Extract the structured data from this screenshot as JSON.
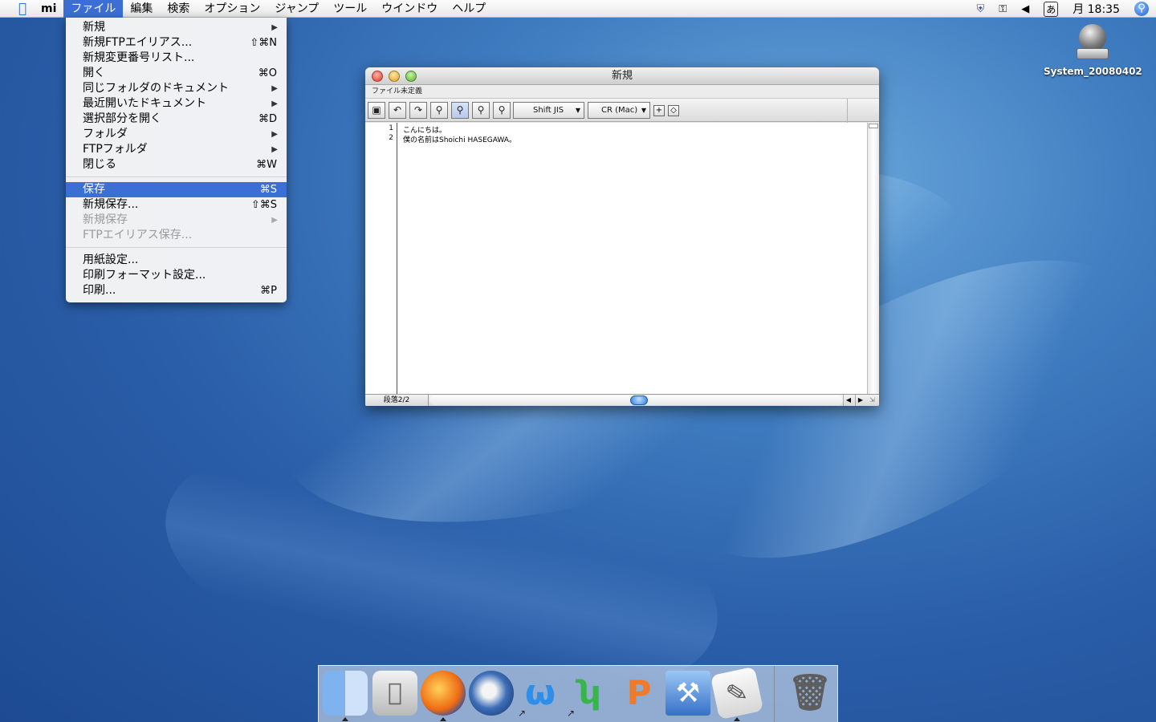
{
  "menubar": {
    "apple_icon": "apple-icon",
    "app_name": "mi",
    "menus": [
      "ファイル",
      "編集",
      "検索",
      "オプション",
      "ジャンプ",
      "ツール",
      "ウインドウ",
      "ヘルプ"
    ],
    "active_menu": "ファイル",
    "status_icons": [
      "shield-icon",
      "binoculars-icon",
      "volume-icon"
    ],
    "input_method": "あ",
    "clock": "月 18:35",
    "spotlight_icon": "spotlight-icon"
  },
  "file_menu": {
    "items": [
      {
        "label": "新規",
        "shortcut": "",
        "submenu": true,
        "state": "enabled"
      },
      {
        "label": "新規FTPエイリアス...",
        "shortcut": "⇧⌘N",
        "submenu": false,
        "state": "enabled"
      },
      {
        "label": "新規変更番号リスト...",
        "shortcut": "",
        "submenu": false,
        "state": "enabled"
      },
      {
        "label": "開く",
        "shortcut": "⌘O",
        "submenu": false,
        "state": "enabled"
      },
      {
        "label": "同じフォルダのドキュメント",
        "shortcut": "",
        "submenu": true,
        "state": "enabled"
      },
      {
        "label": "最近開いたドキュメント",
        "shortcut": "",
        "submenu": true,
        "state": "enabled"
      },
      {
        "label": "選択部分を開く",
        "shortcut": "⌘D",
        "submenu": false,
        "state": "enabled"
      },
      {
        "label": "フォルダ",
        "shortcut": "",
        "submenu": true,
        "state": "enabled"
      },
      {
        "label": "FTPフォルダ",
        "shortcut": "",
        "submenu": true,
        "state": "enabled"
      },
      {
        "label": "閉じる",
        "shortcut": "⌘W",
        "submenu": false,
        "state": "enabled"
      },
      {
        "label": "保存",
        "shortcut": "⌘S",
        "submenu": false,
        "state": "selected"
      },
      {
        "label": "新規保存...",
        "shortcut": "⇧⌘S",
        "submenu": false,
        "state": "enabled"
      },
      {
        "label": "新規保存",
        "shortcut": "",
        "submenu": true,
        "state": "disabled"
      },
      {
        "label": "FTPエイリアス保存...",
        "shortcut": "",
        "submenu": false,
        "state": "disabled"
      },
      {
        "label": "用紙設定...",
        "shortcut": "",
        "submenu": false,
        "state": "enabled"
      },
      {
        "label": "印刷フォーマット設定...",
        "shortcut": "",
        "submenu": false,
        "state": "enabled"
      },
      {
        "label": "印刷...",
        "shortcut": "⌘P",
        "submenu": false,
        "state": "enabled"
      }
    ]
  },
  "editor_window": {
    "title": "新規",
    "file_type": "ファイル未定義",
    "encoding": "Shift JIS",
    "line_ending": "CR (Mac)",
    "lines": [
      {
        "num": "1",
        "text": "こんにちは。"
      },
      {
        "num": "2",
        "text": "僕の名前はShoichi HASEGAWA。"
      }
    ],
    "paragraph_status": "段落2/2",
    "toolbar_icons": [
      "save-icon",
      "undo-icon",
      "redo-icon",
      "find-icon",
      "multi-file-find-icon",
      "search-prev-icon",
      "search-next-icon"
    ]
  },
  "desktop": {
    "drive_label": "System_20080402"
  },
  "dock": {
    "apps": [
      "finder-icon",
      "system-preferences-icon",
      "firefox-icon",
      "thunderbird-icon",
      "mi-icon",
      "smultron-icon",
      "papers-icon",
      "xcode-icon",
      "script-editor-icon"
    ],
    "trash": "trash-icon"
  }
}
